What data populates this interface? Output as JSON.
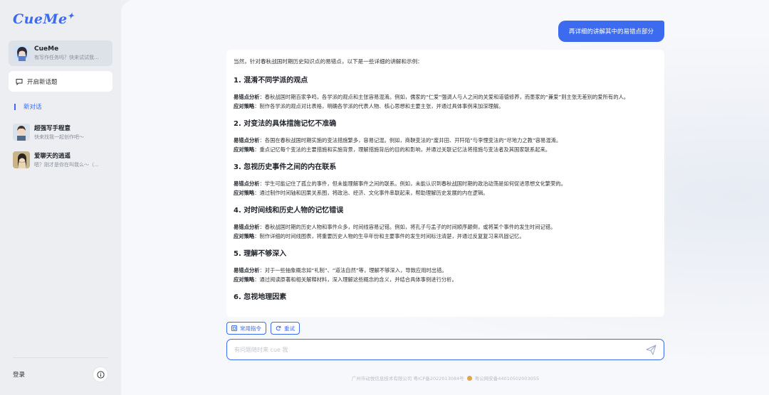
{
  "app": {
    "logo": "CueMe",
    "accent": "#3d6bf0"
  },
  "sidebar": {
    "agent": {
      "name": "CueMe",
      "subtitle": "有写作任务吗？快来试试我..."
    },
    "new_topic_label": "开启新话题",
    "new_chat_label": "新对话",
    "conversations": [
      {
        "name": "超强写手程意",
        "subtitle": "快来找我一起创作吧～"
      },
      {
        "name": "爱聊天的逍遥",
        "subtitle": "嗯？刚才是你在叫我么～（..."
      }
    ],
    "login_label": "登录"
  },
  "chat": {
    "user_message": "再详细的讲解其中的易错点部分",
    "answer": {
      "intro": "当然，针对春秋战国时期历史知识点的易错点，以下是一些详细的讲解和示例：",
      "sections": [
        {
          "title": "1. 混淆不同学派的观点",
          "error_label": "易错点分析",
          "error": "：春秋战国时期百家争鸣，各学派的观点和主张容易混淆。例如，儒家的“仁爱”强调人与人之间的关爱和道德修养，而墨家的“兼爱”则主张无差别的爱所有的人。",
          "strategy_label": "应对策略",
          "strategy": "：制作各学派的观点对比表格，明确各学派的代表人物、核心思想和主要主张，并通过具体事例来加深理解。"
        },
        {
          "title": "2. 对变法的具体措施记忆不准确",
          "error_label": "易错点分析",
          "error": "：各国在春秋战国时期实施的变法措施繁多，容易记混。例如，商鞅变法的“废井田、开阡陌”与李悝变法的“尽地力之教”容易混淆。",
          "strategy_label": "应对策略",
          "strategy": "：重点记忆每个变法的主要措施和实施背景，理解措施背后的目的和影响，并通过关联记忆法将措施与变法者及其国家联系起来。"
        },
        {
          "title": "3. 忽视历史事件之间的内在联系",
          "error_label": "易错点分析",
          "error": "：学生可能记住了孤立的事件，但未能理解事件之间的联系。例如，未能认识到春秋战国时期的政治动荡是如何促进思想文化繁荣的。",
          "strategy_label": "应对策略",
          "strategy": "：通过制作时间轴和因果关系图，将政治、经济、文化事件串联起来，帮助理解历史发展的内在逻辑。"
        },
        {
          "title": "4. 对时间线和历史人物的记忆错误",
          "error_label": "易错点分析",
          "error": "：春秋战国时期的历史人物和事件众多，时间线容易记错。例如，将孔子与孟子的时间顺序颠倒，或将某个事件的发生时间记错。",
          "strategy_label": "应对策略",
          "strategy": "：制作详细的时间线图表，将重要历史人物的生卒年份和主要事件的发生时间标注清楚，并通过反复复习来巩固记忆。"
        },
        {
          "title": "5. 理解不够深入",
          "error_label": "易错点分析",
          "error": "：对于一些抽象概念如“礼制”、“道法自然”等，理解不够深入，导致应用时出错。",
          "strategy_label": "应对策略",
          "strategy": "：通过阅读原著和相关解释材料，深入理解这些概念的含义，并结合具体事例进行分析。"
        },
        {
          "title": "6. 忽视地理因素"
        }
      ]
    },
    "chips": [
      {
        "label": "常用指令",
        "icon": "command-icon"
      },
      {
        "label": "重试",
        "icon": "refresh-icon"
      }
    ],
    "input_placeholder": "有问题随时来 cue 我"
  },
  "footer": {
    "company": "广州市动悦信息技术有限公司 粤ICP备2022013084号",
    "police": "粤公网安备44010502003055"
  }
}
